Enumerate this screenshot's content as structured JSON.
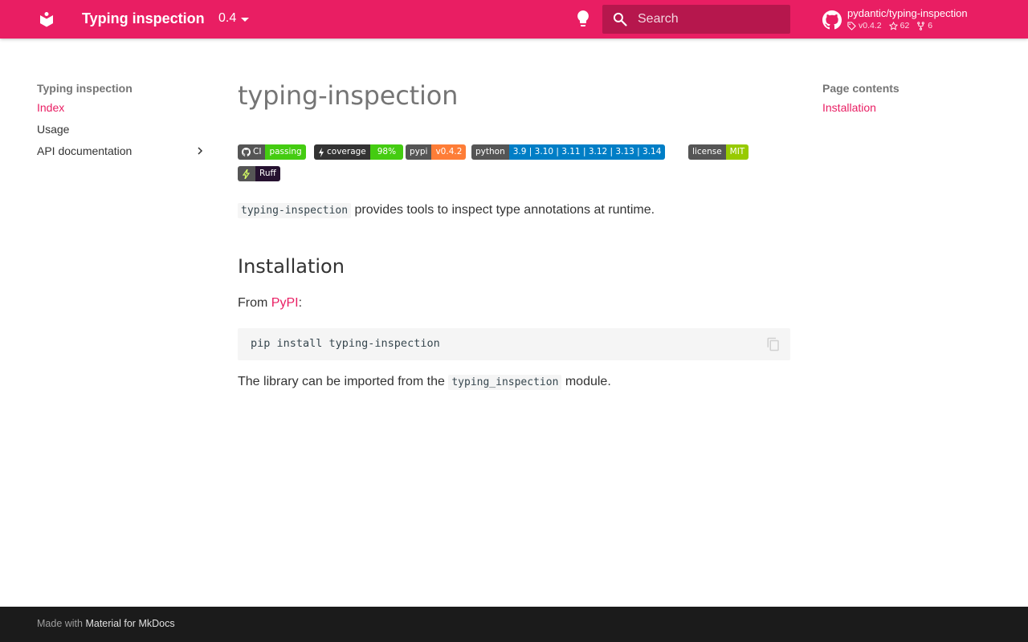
{
  "header": {
    "site_title": "Typing inspection",
    "version": "0.4",
    "search_placeholder": "Search",
    "repo": {
      "name": "pydantic/typing-inspection",
      "release": "v0.4.2",
      "stars": "62",
      "forks": "6"
    },
    "accent_color": "#e91e63"
  },
  "sidebar": {
    "title": "Typing inspection",
    "items": [
      {
        "label": "Index",
        "active": true
      },
      {
        "label": "Usage",
        "active": false
      },
      {
        "label": "API documentation",
        "active": false,
        "expandable": true
      }
    ]
  },
  "main": {
    "title": "typing-inspection",
    "badges": [
      {
        "left": "CI",
        "right": "passing",
        "color": "#4c1",
        "icon": "github-icon"
      },
      {
        "left": "coverage",
        "right": "98%",
        "color": "#4c1",
        "icon": "smokeshow-icon"
      },
      {
        "left": "pypi",
        "right": "v0.4.2",
        "color": "#fe7d37"
      },
      {
        "left": "python",
        "right": "3.9 | 3.10 | 3.11 | 3.12 | 3.13 | 3.14",
        "color": "#007ec6"
      },
      {
        "left": "license",
        "right": "MIT",
        "color": "#97ca00"
      },
      {
        "left": "",
        "right": "Ruff",
        "color": "#261230",
        "icon": "ruff-icon"
      }
    ],
    "intro_code": "typing-inspection",
    "intro_text": " provides tools to inspect type annotations at runtime.",
    "installation_heading": "Installation",
    "from_prefix": "From ",
    "from_link": "PyPI",
    "from_suffix": ":",
    "install_command": "pip install typing-inspection",
    "imported_prefix": "The library can be imported from the ",
    "imported_code": "typing_inspection",
    "imported_suffix": " module."
  },
  "toc": {
    "title": "Page contents",
    "items": [
      {
        "label": "Installation"
      }
    ]
  },
  "footer": {
    "made_with": "Made with ",
    "link": "Material for MkDocs"
  }
}
